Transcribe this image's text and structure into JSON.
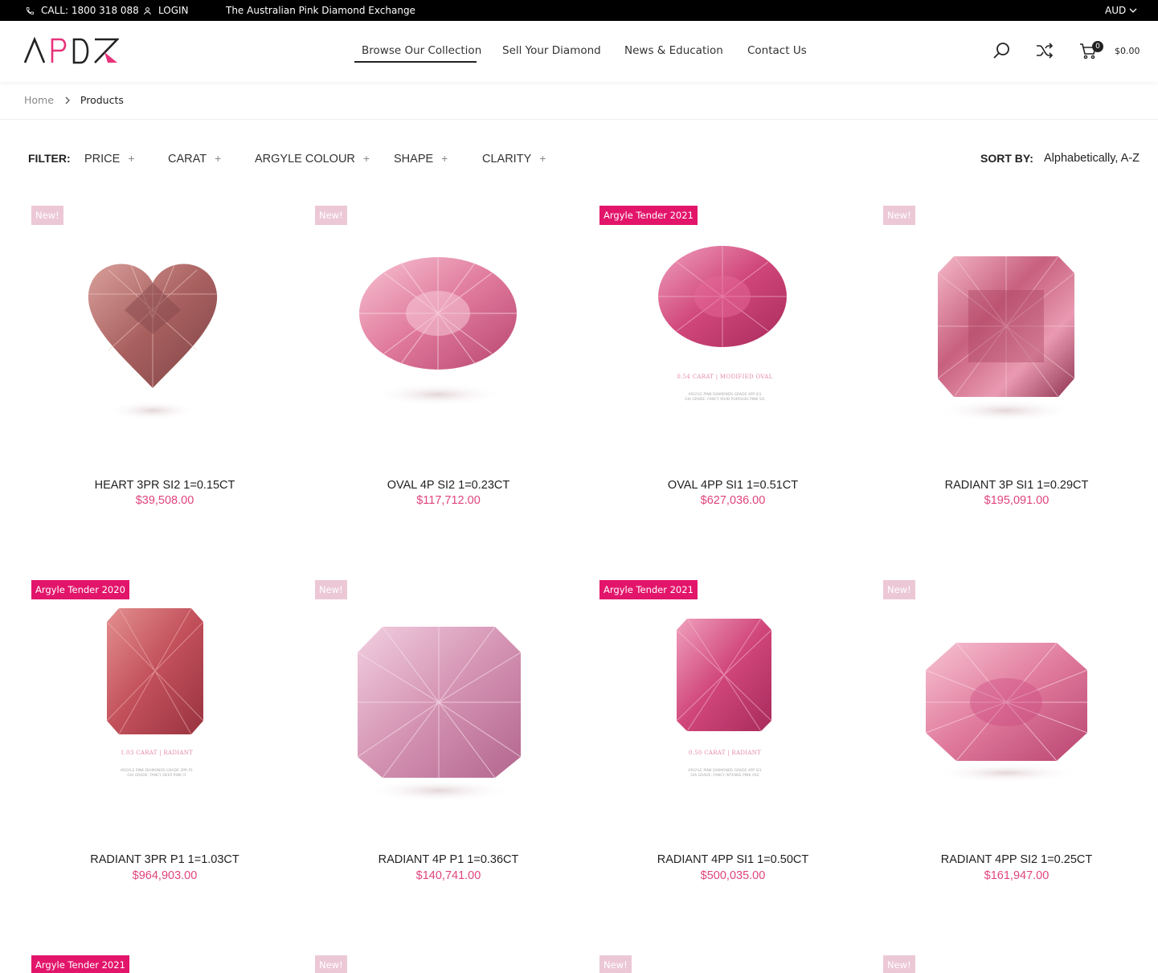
{
  "topbar": {
    "phone_label": "CALL: 1800 318 088",
    "login_label": "LOGIN",
    "tagline": "The Australian Pink Diamond Exchange",
    "currency": "AUD"
  },
  "header": {
    "logo_text": "APDX",
    "nav": [
      {
        "label": "Browse Our Collection",
        "active": true
      },
      {
        "label": "Sell Your Diamond"
      },
      {
        "label": "News & Education"
      },
      {
        "label": "Contact Us"
      }
    ],
    "cart_count": "0",
    "cart_total": "$0.00"
  },
  "breadcrumb": {
    "home": "Home",
    "current": "Products"
  },
  "filters": {
    "label": "FILTER:",
    "items": [
      "PRICE",
      "CARAT",
      "ARGYLE COLOUR",
      "SHAPE",
      "CLARITY"
    ],
    "plus": "+",
    "sort_label": "SORT BY:",
    "sort_value": "Alphabetically, A-Z"
  },
  "products": [
    {
      "badge": "New!",
      "badge_type": "new",
      "title": "HEART 3PR SI2 1=0.15CT",
      "price": "$39,508.00",
      "shape": "heart"
    },
    {
      "badge": "New!",
      "badge_type": "new",
      "title": "OVAL 4P SI2 1=0.23CT",
      "price": "$117,712.00",
      "shape": "oval"
    },
    {
      "badge": "Argyle Tender 2021",
      "badge_type": "tender",
      "title": "OVAL 4PP SI1 1=0.51CT",
      "price": "$627,036.00",
      "shape": "oval-small",
      "caption": "0.54 CARAT | MODIFIED OVAL",
      "caption_sub1": "ARGYLE PINK DIAMONDS GRADE 4PP SI1",
      "caption_sub2": "GIA GRADE: FANCY VIVID PURPLISH PINK SI1"
    },
    {
      "badge": "New!",
      "badge_type": "new",
      "title": "RADIANT 3P SI1 1=0.29CT",
      "price": "$195,091.00",
      "shape": "radiant-square"
    },
    {
      "badge": "Argyle Tender 2020",
      "badge_type": "tender",
      "title": "RADIANT 3PR P1 1=1.03CT",
      "price": "$964,903.00",
      "shape": "radiant-tall",
      "caption": "1.03 CARAT | RADIANT",
      "caption_sub1": "ARGYLE PINK DIAMONDS GRADE 3PR P1",
      "caption_sub2": "GIA GRADE: FANCY DEEP PINK I1"
    },
    {
      "badge": "New!",
      "badge_type": "new",
      "title": "RADIANT 4P P1 1=0.36CT",
      "price": "$140,741.00",
      "shape": "radiant-wide"
    },
    {
      "badge": "Argyle Tender 2021",
      "badge_type": "tender",
      "title": "RADIANT 4PP SI1 1=0.50CT",
      "price": "$500,035.00",
      "shape": "radiant-small",
      "caption": "0.50 CARAT | RADIANT",
      "caption_sub1": "ARGYLE PINK DIAMONDS GRADE 4PP SI1",
      "caption_sub2": "GIA GRADE: FANCY INTENSE PINK VS2"
    },
    {
      "badge": "New!",
      "badge_type": "new",
      "title": "RADIANT 4PP SI2 1=0.25CT",
      "price": "$161,947.00",
      "shape": "radiant-oct"
    },
    {
      "badge": "Argyle Tender 2021",
      "badge_type": "tender"
    },
    {
      "badge": "New!",
      "badge_type": "new"
    },
    {
      "badge": "New!",
      "badge_type": "new"
    },
    {
      "badge": "New!",
      "badge_type": "new"
    }
  ],
  "colors": {
    "accent_pink": "#e2156b",
    "price_pink": "#e0447c",
    "new_badge": "#ecc8d6",
    "topbar_bg": "#000000"
  }
}
